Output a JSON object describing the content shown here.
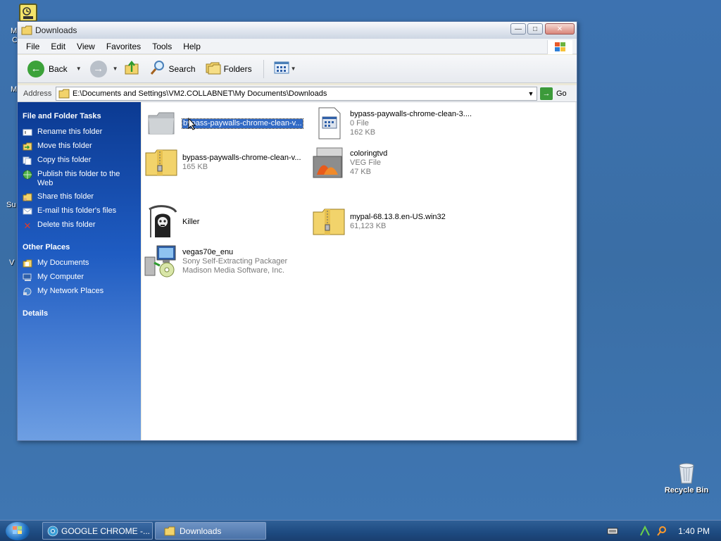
{
  "window": {
    "title": "Downloads",
    "minimize_glyph": "—",
    "maximize_glyph": "□",
    "close_glyph": "✕"
  },
  "menu": [
    "File",
    "Edit",
    "View",
    "Favorites",
    "Tools",
    "Help"
  ],
  "toolbar": {
    "back_label": "Back",
    "search_label": "Search",
    "folders_label": "Folders"
  },
  "address": {
    "label": "Address",
    "value": "E:\\Documents and Settings\\VM2.COLLABNET\\My Documents\\Downloads",
    "go_label": "Go"
  },
  "tasks": {
    "heading": "File and Folder Tasks",
    "items": [
      "Rename this folder",
      "Move this folder",
      "Copy this folder",
      "Publish this folder to the Web",
      "Share this folder",
      "E-mail this folder's files",
      "Delete this folder"
    ]
  },
  "other_places": {
    "heading": "Other Places",
    "items": [
      "My Documents",
      "My Computer",
      "My Network Places"
    ]
  },
  "details": {
    "heading": "Details"
  },
  "files": [
    {
      "name": "bypass-paywalls-chrome-clean-v...",
      "type": "",
      "size": "",
      "icon": "folder-icon"
    },
    {
      "name": "bypass-paywalls-chrome-clean-3....",
      "type": "0 File",
      "size": "162 KB",
      "icon": "generic-file-icon"
    },
    {
      "name": "bypass-paywalls-chrome-clean-v...",
      "type": "165 KB",
      "size": "",
      "icon": "zip-folder-icon"
    },
    {
      "name": "coloringtvd",
      "type": "VEG File",
      "size": "47 KB",
      "icon": "veg-file-icon"
    },
    {
      "name": "Killer",
      "type": "",
      "size": "",
      "icon": "skull-reaper-icon"
    },
    {
      "name": "mypal-68.13.8.en-US.win32",
      "type": "61,123 KB",
      "size": "",
      "icon": "zip-folder-icon"
    },
    {
      "name": "vegas70e_enu",
      "type": "Sony Self-Extracting Packager",
      "size": "Madison Media Software, Inc.",
      "icon": "installer-icon"
    }
  ],
  "desktop": {
    "recycle_bin_label": "Recycle Bin",
    "edge_letters": [
      "M",
      "C",
      "M",
      "Su",
      "V"
    ]
  },
  "taskbar": {
    "tasks": [
      "GOOGLE CHROME -...",
      "Downloads"
    ],
    "clock": "1:40 PM"
  }
}
